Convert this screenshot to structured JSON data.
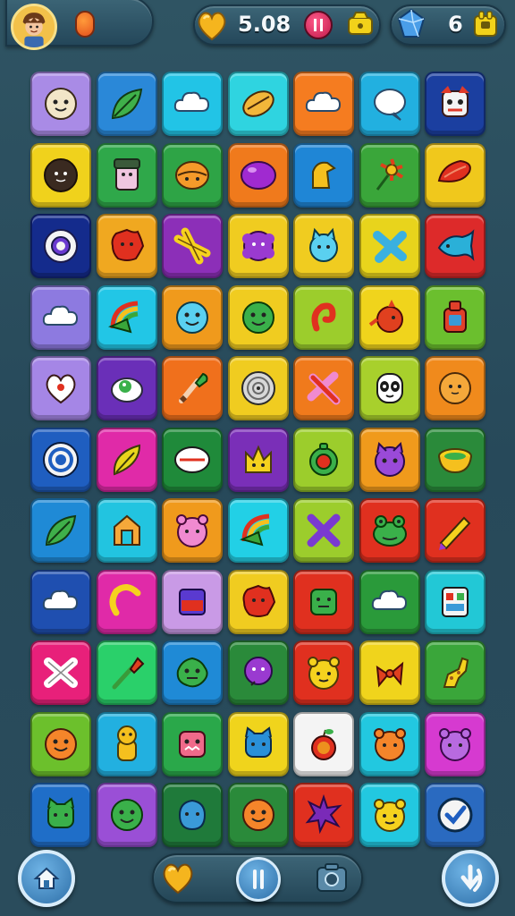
{
  "top_bar": {
    "gold": {
      "value": "5.08",
      "icon": "gold-heart-icon"
    },
    "gems": {
      "value": "6",
      "icon": "blue-gem-icon"
    }
  },
  "board": {
    "rows": 11,
    "cols": 7,
    "tiles": [
      [
        {
          "bg": "#a98be6",
          "icon": "face"
        },
        {
          "bg": "#2a88d8",
          "icon": "leaf"
        },
        {
          "bg": "#22c4e6",
          "icon": "cloud"
        },
        {
          "bg": "#2fd4e0",
          "icon": "seed"
        },
        {
          "bg": "#f57c20",
          "icon": "cloud"
        },
        {
          "bg": "#22b0e0",
          "icon": "bubble"
        },
        {
          "bg": "#1b3fa0",
          "icon": "robot"
        }
      ],
      [
        {
          "bg": "#f0d21c",
          "icon": "blob"
        },
        {
          "bg": "#2fa84a",
          "icon": "cup"
        },
        {
          "bg": "#2ea446",
          "icon": "orange"
        },
        {
          "bg": "#f07a1c",
          "icon": "purple-ball"
        },
        {
          "bg": "#1f86d6",
          "icon": "boot"
        },
        {
          "bg": "#3aa63a",
          "icon": "flower"
        },
        {
          "bg": "#f0c81c",
          "icon": "pepper"
        }
      ],
      [
        {
          "bg": "#142b8c",
          "icon": "ring"
        },
        {
          "bg": "#f0a820",
          "icon": "red-blob"
        },
        {
          "bg": "#8c2fb8",
          "icon": "star"
        },
        {
          "bg": "#f0cc20",
          "icon": "flower-purple"
        },
        {
          "bg": "#f0cc20",
          "icon": "cat"
        },
        {
          "bg": "#e8d41c",
          "icon": "cross"
        },
        {
          "bg": "#dd2a2a",
          "icon": "fish"
        }
      ],
      [
        {
          "bg": "#8d7ae0",
          "icon": "cloud"
        },
        {
          "bg": "#22c6e6",
          "icon": "rainbow"
        },
        {
          "bg": "#f09a1c",
          "icon": "blue-smile"
        },
        {
          "bg": "#f0cc20",
          "icon": "green-smile"
        },
        {
          "bg": "#9ccd2c",
          "icon": "hook"
        },
        {
          "bg": "#f0d41c",
          "icon": "bird"
        },
        {
          "bg": "#6bbf2e",
          "icon": "bottle"
        }
      ],
      [
        {
          "bg": "#a586e6",
          "icon": "heart"
        },
        {
          "bg": "#6a2fb8",
          "icon": "egg"
        },
        {
          "bg": "#f0701c",
          "icon": "brush"
        },
        {
          "bg": "#f0cc20",
          "icon": "disc"
        },
        {
          "bg": "#f07a1c",
          "icon": "cross-red"
        },
        {
          "bg": "#a8d02c",
          "icon": "panda"
        },
        {
          "bg": "#f08a1c",
          "icon": "orange-ball"
        }
      ],
      [
        {
          "bg": "#1f5ec0",
          "icon": "target"
        },
        {
          "bg": "#e02aa8",
          "icon": "leaf-y"
        },
        {
          "bg": "#1f8a3a",
          "icon": "mouth"
        },
        {
          "bg": "#7a2fb8",
          "icon": "crown"
        },
        {
          "bg": "#9ccd2c",
          "icon": "clock"
        },
        {
          "bg": "#f09a1c",
          "icon": "purple-cat"
        },
        {
          "bg": "#2a8a3a",
          "icon": "pot"
        }
      ],
      [
        {
          "bg": "#1f8ad6",
          "icon": "leaf"
        },
        {
          "bg": "#22c4e0",
          "icon": "house"
        },
        {
          "bg": "#f09a1c",
          "icon": "pink-bear"
        },
        {
          "bg": "#22d0e6",
          "icon": "rainbow"
        },
        {
          "bg": "#9ccd2c",
          "icon": "cross-purple"
        },
        {
          "bg": "#e0301f",
          "icon": "frog"
        },
        {
          "bg": "#e0301f",
          "icon": "pencil"
        }
      ],
      [
        {
          "bg": "#1f4fb0",
          "icon": "cloud"
        },
        {
          "bg": "#e02aa8",
          "icon": "c-shape"
        },
        {
          "bg": "#c99ae6",
          "icon": "box"
        },
        {
          "bg": "#f0cc20",
          "icon": "red-blob"
        },
        {
          "bg": "#e0301f",
          "icon": "green-square"
        },
        {
          "bg": "#2a9a3a",
          "icon": "cloud"
        },
        {
          "bg": "#22c8d6",
          "icon": "panel"
        }
      ],
      [
        {
          "bg": "#e8207a",
          "icon": "cross-white"
        },
        {
          "bg": "#2ad06a",
          "icon": "shovel"
        },
        {
          "bg": "#1f8ad6",
          "icon": "green-monster"
        },
        {
          "bg": "#2a8a3a",
          "icon": "purple-ball-face"
        },
        {
          "bg": "#e0301f",
          "icon": "yellow-bear"
        },
        {
          "bg": "#f0d41c",
          "icon": "bow"
        },
        {
          "bg": "#3aa63a",
          "icon": "giraffe"
        }
      ],
      [
        {
          "bg": "#6cc02c",
          "icon": "orange-face"
        },
        {
          "bg": "#22b0e0",
          "icon": "bear-standing"
        },
        {
          "bg": "#2aa84a",
          "icon": "pink-square"
        },
        {
          "bg": "#f0d41c",
          "icon": "blue-cat"
        },
        {
          "bg": "#f4f4f4",
          "icon": "apple"
        },
        {
          "bg": "#22c8e0",
          "icon": "orange-bear"
        },
        {
          "bg": "#d63ad0",
          "icon": "purple-bear"
        }
      ],
      [
        {
          "bg": "#1f6ec8",
          "icon": "green-cat"
        },
        {
          "bg": "#9a4fd6",
          "icon": "green-smile"
        },
        {
          "bg": "#1f7a3a",
          "icon": "blue-face"
        },
        {
          "bg": "#2a8a3a",
          "icon": "orange-face"
        },
        {
          "bg": "#e0301f",
          "icon": "purple-star"
        },
        {
          "bg": "#22c8e0",
          "icon": "yellow-bear"
        },
        {
          "bg": "#2a6ac0",
          "icon": "check"
        }
      ]
    ]
  },
  "bottom_bar": {
    "home": "home-icon",
    "heart": "heart-icon",
    "info": "info-icon",
    "camera": "camera-icon",
    "back": "back-arrow-icon"
  }
}
